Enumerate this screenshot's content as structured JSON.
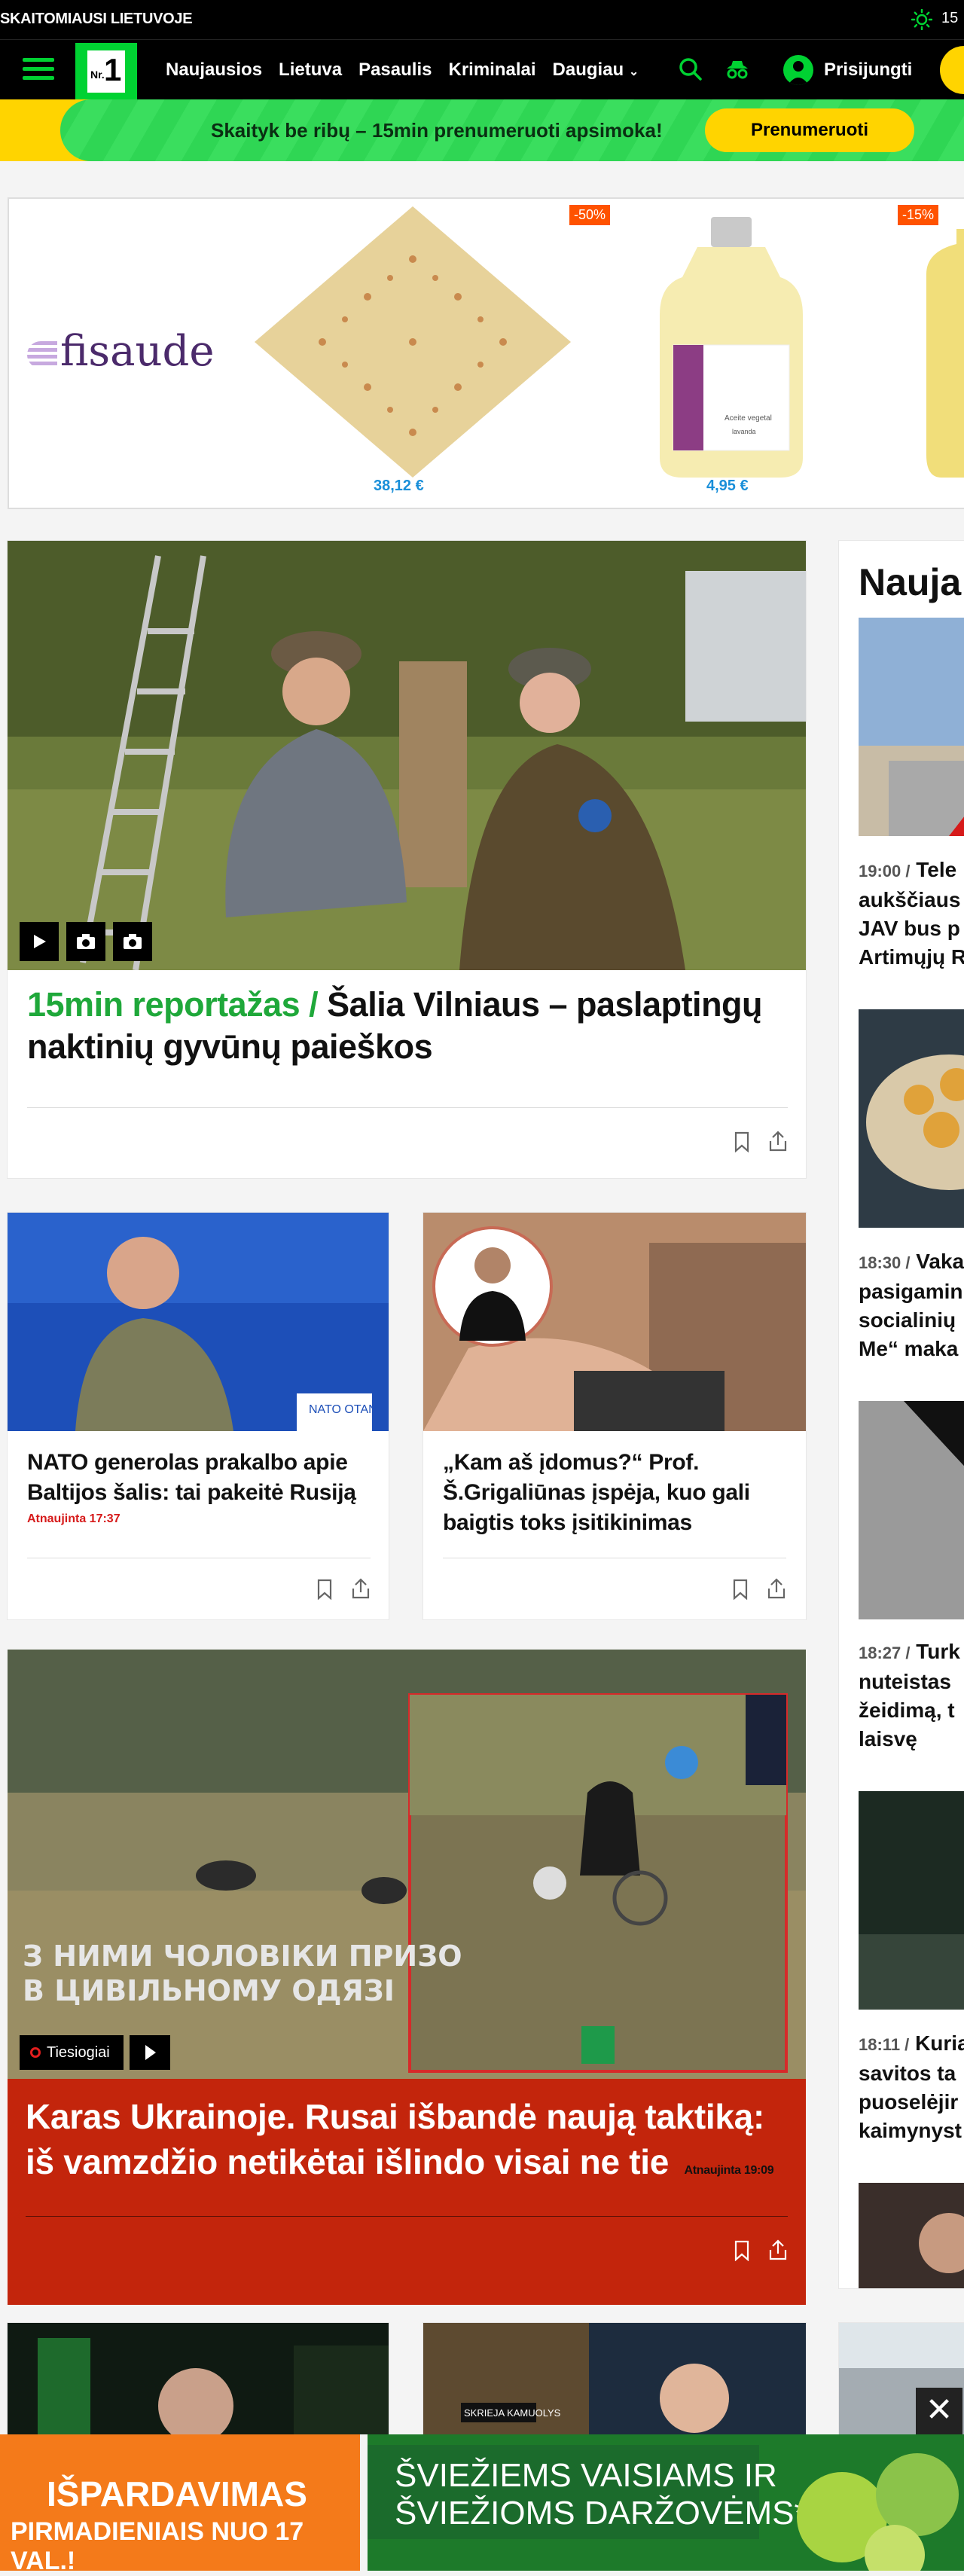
{
  "topbar": {
    "slogan": "SKAITOMIAUSI LIETUVOJE",
    "temperature": "15"
  },
  "nav": {
    "logo_nr": "Nr.",
    "logo_one": "1",
    "links": [
      "Naujausios",
      "Lietuva",
      "Pasaulis",
      "Kriminalai",
      "Daugiau"
    ],
    "login_label": "Prisijungti"
  },
  "promo": {
    "text": "Skaityk be ribų – 15min prenumeruoti apsimoka!",
    "button": "Prenumeruoti"
  },
  "ad": {
    "brand": "fisaude",
    "products": [
      {
        "price": "38,12 €",
        "discount": "-50%"
      },
      {
        "price": "4,95 €",
        "discount": "-15%"
      }
    ],
    "bottle_label_1": "Aceite vegetal",
    "bottle_label_2": "lavanda"
  },
  "hero": {
    "kicker": "15min reportažas /",
    "title": "Šalia Vilniaus – paslaptingų naktinių gyvūnų paieškos"
  },
  "articles": [
    {
      "title": "NATO generolas prakalbo apie Baltijos šalis: tai pakeitė Rusiją",
      "updated": "Atnaujinta 17:37",
      "sign": "NATO OTAN"
    },
    {
      "title": "„Kam aš įdomus?“ Prof. Š.Grigaliūnas įspėja, kuo gali baigtis toks įsitikinimas"
    }
  ],
  "live_article": {
    "live_label": "Tiesiogiai",
    "title": "Karas Ukrainoje. Rusai išbandė naują taktiką: iš vamzdžio netikėtai išlindo visai ne tie",
    "updated": "Atnaujinta 19:09",
    "overlay_line1": "З НИМИ ЧОЛОВІКИ ПРИЗО",
    "overlay_line2": "В ЦИВІЛЬНОМУ ОДЯЗІ"
  },
  "sidebar": {
    "heading": "Nauja",
    "items": [
      {
        "time": "19:00 /",
        "lines": [
          "Tele",
          "aukščiaus",
          "JAV bus p",
          "Artimųjų R"
        ]
      },
      {
        "time": "18:30 /",
        "lines": [
          "Vaka",
          "pasigamin",
          "socialinių",
          "Me“ maka"
        ]
      },
      {
        "time": "18:27 /",
        "lines": [
          "Turk",
          "nuteistas",
          "žeidimą, t",
          "laisvę"
        ]
      },
      {
        "time": "18:11 /",
        "lines": [
          "Kuria",
          "savitos ta",
          "puoselėjir",
          "kaimynyst"
        ]
      }
    ]
  },
  "bottom_row": {
    "badge_text": "SKRIEJA KAMUOLYS"
  },
  "bottom_ad": {
    "orange_line1": "IŠPARDAVIMAS",
    "orange_line2": "PIRMADIENIAIS NUO 17 VAL.!",
    "green_line1": "ŠVIEŽIEMS VAISIAMS IR",
    "green_line2": "ŠVIEŽIOMS DARŽOVĖMS*",
    "close": "✕"
  },
  "colors": {
    "brand_green": "#00d232",
    "accent_yellow": "#ffd400",
    "live_red": "#c3250c",
    "kicker_green": "#1fa83a"
  }
}
